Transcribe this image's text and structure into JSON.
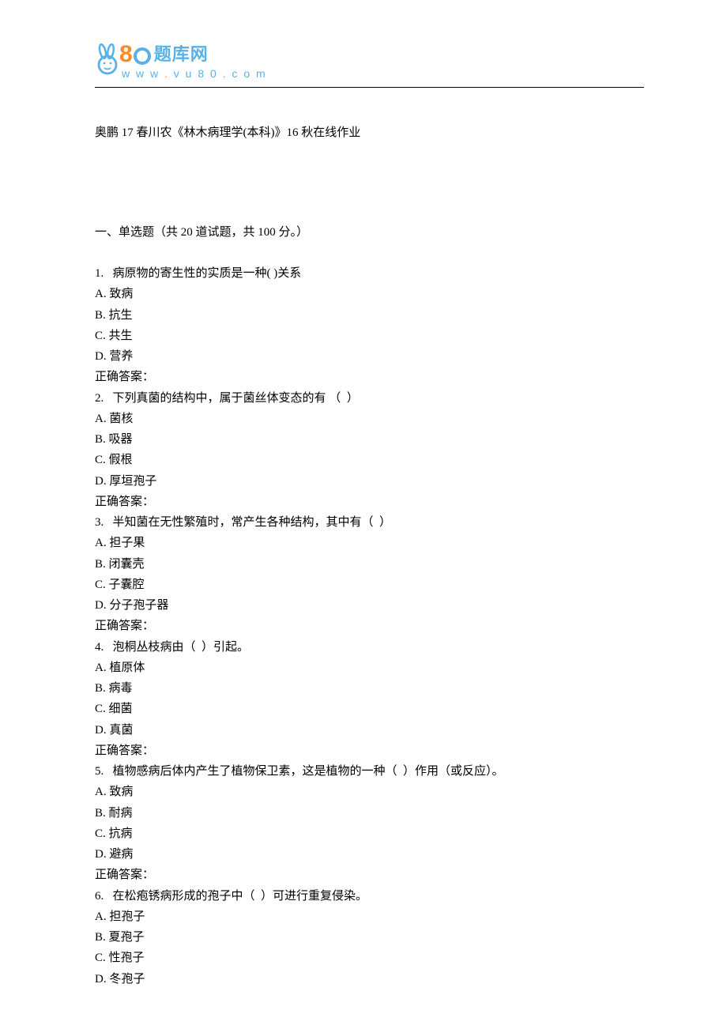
{
  "logo": {
    "cn": "题库网",
    "url_prefix": "w w w ",
    "url_mid": "v u 8 0",
    "url_suffix": "c o m"
  },
  "doc": {
    "title": "奥鹏 17 春川农《林木病理学(本科)》16 秋在线作业",
    "section": "一、单选题（共 20 道试题，共 100 分。）"
  },
  "questions": [
    {
      "q": "1.   病原物的寄生性的实质是一种( )关系",
      "opts": [
        "A. 致病",
        "B. 抗生",
        "C. 共生",
        "D. 营养"
      ],
      "ans": "正确答案："
    },
    {
      "q": "2.   下列真菌的结构中，属于菌丝体变态的有 （  ）",
      "opts": [
        "A. 菌核",
        "B. 吸器",
        "C. 假根",
        "D. 厚垣孢子"
      ],
      "ans": "正确答案："
    },
    {
      "q": "3.   半知菌在无性繁殖时，常产生各种结构，其中有（  ）",
      "opts": [
        "A. 担子果",
        "B. 闭囊壳",
        "C. 子囊腔",
        "D. 分子孢子器"
      ],
      "ans": "正确答案："
    },
    {
      "q": "4.   泡桐丛枝病由（  ）引起。",
      "opts": [
        "A. 植原体",
        "B. 病毒",
        "C. 细菌",
        "D. 真菌"
      ],
      "ans": "正确答案："
    },
    {
      "q": "5.   植物感病后体内产生了植物保卫素，这是植物的一种（  ）作用（或反应）。",
      "opts": [
        "A. 致病",
        "B. 耐病",
        "C. 抗病",
        "D. 避病"
      ],
      "ans": "正确答案："
    },
    {
      "q": "6.   在松疱锈病形成的孢子中（  ）可进行重复侵染。",
      "opts": [
        "A. 担孢子",
        "B. 夏孢子",
        "C. 性孢子",
        "D. 冬孢子"
      ],
      "ans": ""
    }
  ]
}
